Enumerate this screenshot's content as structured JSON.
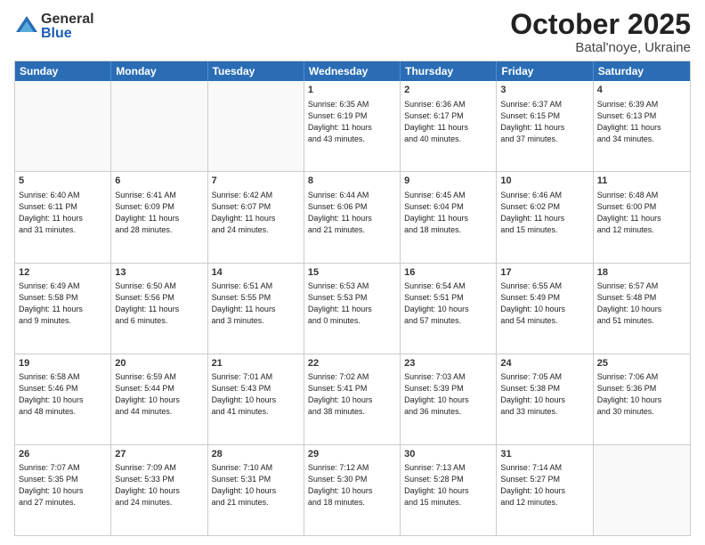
{
  "logo": {
    "general": "General",
    "blue": "Blue"
  },
  "title": "October 2025",
  "location": "Batal'noye, Ukraine",
  "days": [
    "Sunday",
    "Monday",
    "Tuesday",
    "Wednesday",
    "Thursday",
    "Friday",
    "Saturday"
  ],
  "rows": [
    [
      {
        "day": "",
        "lines": []
      },
      {
        "day": "",
        "lines": []
      },
      {
        "day": "",
        "lines": []
      },
      {
        "day": "1",
        "lines": [
          "Sunrise: 6:35 AM",
          "Sunset: 6:19 PM",
          "Daylight: 11 hours",
          "and 43 minutes."
        ]
      },
      {
        "day": "2",
        "lines": [
          "Sunrise: 6:36 AM",
          "Sunset: 6:17 PM",
          "Daylight: 11 hours",
          "and 40 minutes."
        ]
      },
      {
        "day": "3",
        "lines": [
          "Sunrise: 6:37 AM",
          "Sunset: 6:15 PM",
          "Daylight: 11 hours",
          "and 37 minutes."
        ]
      },
      {
        "day": "4",
        "lines": [
          "Sunrise: 6:39 AM",
          "Sunset: 6:13 PM",
          "Daylight: 11 hours",
          "and 34 minutes."
        ]
      }
    ],
    [
      {
        "day": "5",
        "lines": [
          "Sunrise: 6:40 AM",
          "Sunset: 6:11 PM",
          "Daylight: 11 hours",
          "and 31 minutes."
        ]
      },
      {
        "day": "6",
        "lines": [
          "Sunrise: 6:41 AM",
          "Sunset: 6:09 PM",
          "Daylight: 11 hours",
          "and 28 minutes."
        ]
      },
      {
        "day": "7",
        "lines": [
          "Sunrise: 6:42 AM",
          "Sunset: 6:07 PM",
          "Daylight: 11 hours",
          "and 24 minutes."
        ]
      },
      {
        "day": "8",
        "lines": [
          "Sunrise: 6:44 AM",
          "Sunset: 6:06 PM",
          "Daylight: 11 hours",
          "and 21 minutes."
        ]
      },
      {
        "day": "9",
        "lines": [
          "Sunrise: 6:45 AM",
          "Sunset: 6:04 PM",
          "Daylight: 11 hours",
          "and 18 minutes."
        ]
      },
      {
        "day": "10",
        "lines": [
          "Sunrise: 6:46 AM",
          "Sunset: 6:02 PM",
          "Daylight: 11 hours",
          "and 15 minutes."
        ]
      },
      {
        "day": "11",
        "lines": [
          "Sunrise: 6:48 AM",
          "Sunset: 6:00 PM",
          "Daylight: 11 hours",
          "and 12 minutes."
        ]
      }
    ],
    [
      {
        "day": "12",
        "lines": [
          "Sunrise: 6:49 AM",
          "Sunset: 5:58 PM",
          "Daylight: 11 hours",
          "and 9 minutes."
        ]
      },
      {
        "day": "13",
        "lines": [
          "Sunrise: 6:50 AM",
          "Sunset: 5:56 PM",
          "Daylight: 11 hours",
          "and 6 minutes."
        ]
      },
      {
        "day": "14",
        "lines": [
          "Sunrise: 6:51 AM",
          "Sunset: 5:55 PM",
          "Daylight: 11 hours",
          "and 3 minutes."
        ]
      },
      {
        "day": "15",
        "lines": [
          "Sunrise: 6:53 AM",
          "Sunset: 5:53 PM",
          "Daylight: 11 hours",
          "and 0 minutes."
        ]
      },
      {
        "day": "16",
        "lines": [
          "Sunrise: 6:54 AM",
          "Sunset: 5:51 PM",
          "Daylight: 10 hours",
          "and 57 minutes."
        ]
      },
      {
        "day": "17",
        "lines": [
          "Sunrise: 6:55 AM",
          "Sunset: 5:49 PM",
          "Daylight: 10 hours",
          "and 54 minutes."
        ]
      },
      {
        "day": "18",
        "lines": [
          "Sunrise: 6:57 AM",
          "Sunset: 5:48 PM",
          "Daylight: 10 hours",
          "and 51 minutes."
        ]
      }
    ],
    [
      {
        "day": "19",
        "lines": [
          "Sunrise: 6:58 AM",
          "Sunset: 5:46 PM",
          "Daylight: 10 hours",
          "and 48 minutes."
        ]
      },
      {
        "day": "20",
        "lines": [
          "Sunrise: 6:59 AM",
          "Sunset: 5:44 PM",
          "Daylight: 10 hours",
          "and 44 minutes."
        ]
      },
      {
        "day": "21",
        "lines": [
          "Sunrise: 7:01 AM",
          "Sunset: 5:43 PM",
          "Daylight: 10 hours",
          "and 41 minutes."
        ]
      },
      {
        "day": "22",
        "lines": [
          "Sunrise: 7:02 AM",
          "Sunset: 5:41 PM",
          "Daylight: 10 hours",
          "and 38 minutes."
        ]
      },
      {
        "day": "23",
        "lines": [
          "Sunrise: 7:03 AM",
          "Sunset: 5:39 PM",
          "Daylight: 10 hours",
          "and 36 minutes."
        ]
      },
      {
        "day": "24",
        "lines": [
          "Sunrise: 7:05 AM",
          "Sunset: 5:38 PM",
          "Daylight: 10 hours",
          "and 33 minutes."
        ]
      },
      {
        "day": "25",
        "lines": [
          "Sunrise: 7:06 AM",
          "Sunset: 5:36 PM",
          "Daylight: 10 hours",
          "and 30 minutes."
        ]
      }
    ],
    [
      {
        "day": "26",
        "lines": [
          "Sunrise: 7:07 AM",
          "Sunset: 5:35 PM",
          "Daylight: 10 hours",
          "and 27 minutes."
        ]
      },
      {
        "day": "27",
        "lines": [
          "Sunrise: 7:09 AM",
          "Sunset: 5:33 PM",
          "Daylight: 10 hours",
          "and 24 minutes."
        ]
      },
      {
        "day": "28",
        "lines": [
          "Sunrise: 7:10 AM",
          "Sunset: 5:31 PM",
          "Daylight: 10 hours",
          "and 21 minutes."
        ]
      },
      {
        "day": "29",
        "lines": [
          "Sunrise: 7:12 AM",
          "Sunset: 5:30 PM",
          "Daylight: 10 hours",
          "and 18 minutes."
        ]
      },
      {
        "day": "30",
        "lines": [
          "Sunrise: 7:13 AM",
          "Sunset: 5:28 PM",
          "Daylight: 10 hours",
          "and 15 minutes."
        ]
      },
      {
        "day": "31",
        "lines": [
          "Sunrise: 7:14 AM",
          "Sunset: 5:27 PM",
          "Daylight: 10 hours",
          "and 12 minutes."
        ]
      },
      {
        "day": "",
        "lines": []
      }
    ]
  ]
}
